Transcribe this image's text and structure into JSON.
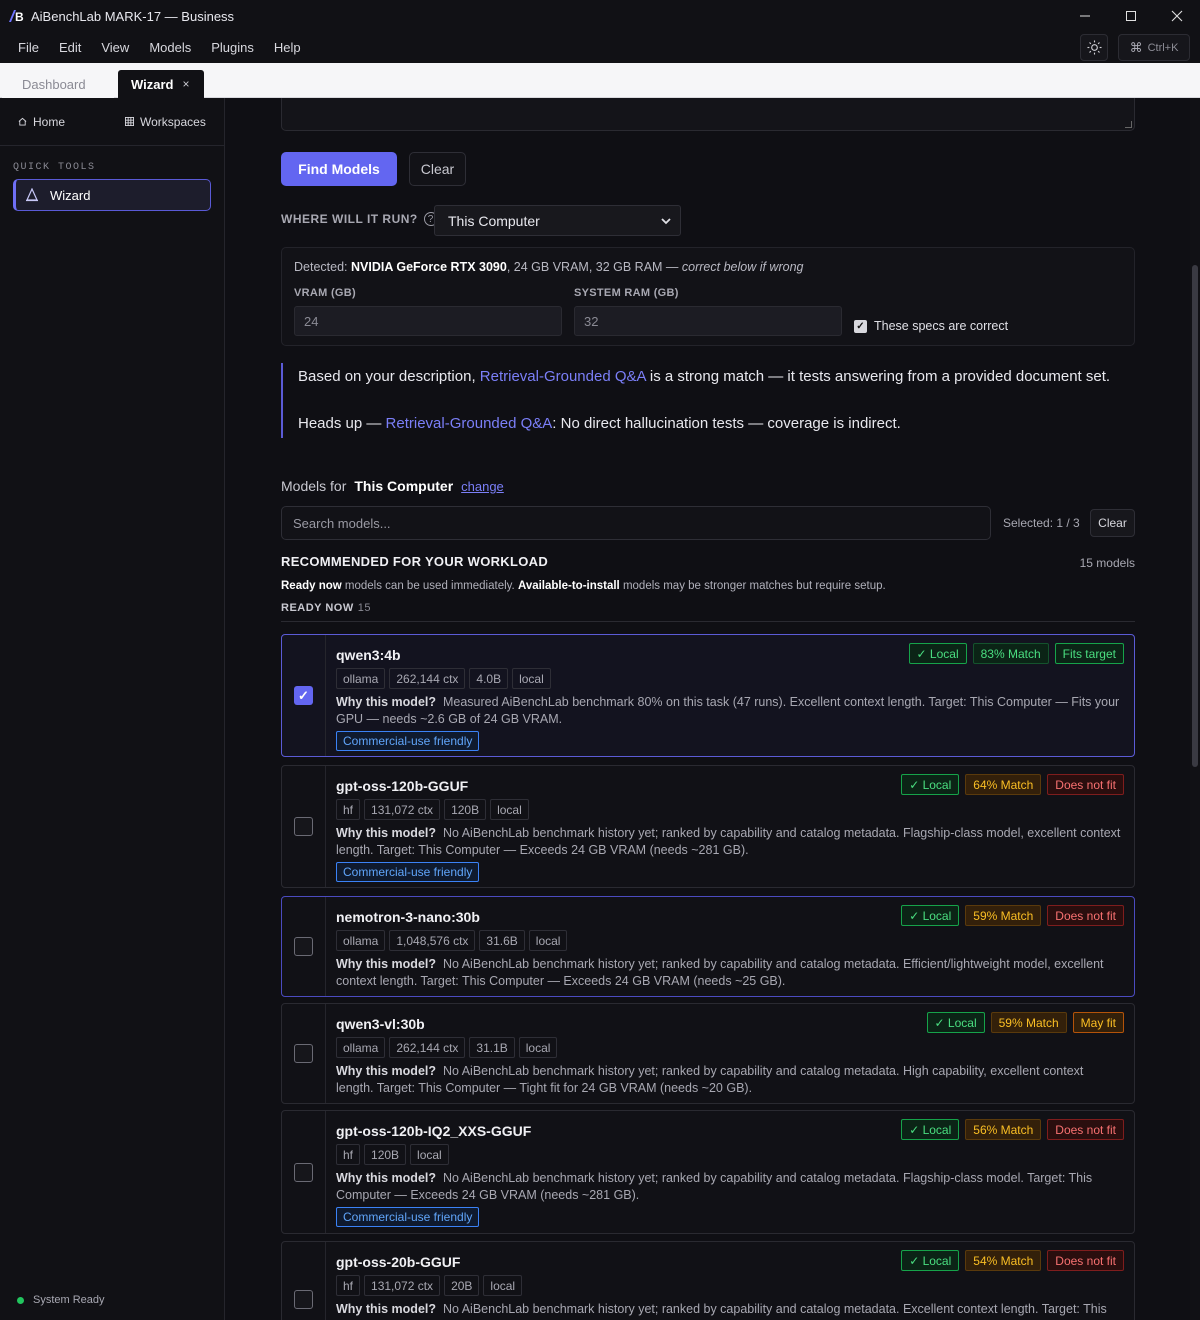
{
  "window": {
    "title": "AiBenchLab MARK-17 — Business",
    "logo_text": "/B",
    "controls": {
      "minimize": "—",
      "maximize": "☐",
      "close": "✕"
    }
  },
  "menu": {
    "items": [
      "File",
      "Edit",
      "View",
      "Models",
      "Plugins",
      "Help"
    ],
    "shortcut": "Ctrl+K"
  },
  "tabs": [
    {
      "label": "Dashboard",
      "active": false
    },
    {
      "label": "Wizard",
      "active": true,
      "close": "×"
    }
  ],
  "sidebar": {
    "home": "Home",
    "workspaces": "Workspaces",
    "section": "QUICK TOOLS",
    "active_item": "Wizard",
    "status": "System Ready",
    "status_color": "#22c55e"
  },
  "actions": {
    "find": "Find Models",
    "clear": "Clear"
  },
  "run": {
    "label": "WHERE WILL IT RUN?",
    "help": "?",
    "selected": "This Computer"
  },
  "specs": {
    "detected_prefix": "Detected:",
    "gpu": "NVIDIA GeForce RTX 3090",
    "details": ", 24 GB VRAM, 32 GB RAM — ",
    "hint": "correct below if wrong",
    "vram_label": "VRAM (GB)",
    "vram_value": "24",
    "ram_label": "SYSTEM RAM (GB)",
    "ram_value": "32",
    "confirm_label": "These specs are correct",
    "confirm_checked": true
  },
  "callout": {
    "line1_prefix": "Based on your description, ",
    "line1_link": "Retrieval-Grounded Q&A",
    "line1_suffix": " is a strong match — it tests answering from a provided document set.",
    "line2_prefix": "Heads up — ",
    "line2_link": "Retrieval-Grounded Q&A",
    "line2_suffix": ": No direct hallucination tests — coverage is indirect."
  },
  "models_for": {
    "prefix": "Models for",
    "target": "This Computer",
    "change": "change"
  },
  "search": {
    "placeholder": "Search models...",
    "selected": "Selected: 1 / 3",
    "clear": "Clear"
  },
  "recommended": {
    "title": "RECOMMENDED FOR YOUR WORKLOAD",
    "count": "15 models",
    "desc_b1": "Ready now",
    "desc_t1": " models can be used immediately. ",
    "desc_b2": "Available-to-install",
    "desc_t2": " models may be stronger matches but require setup.",
    "ready_label": "READY NOW",
    "ready_count": "15"
  },
  "why_label": "Why this model?",
  "models": [
    {
      "name": "qwen3:4b",
      "tags": [
        "ollama",
        "262,144 ctx",
        "4.0B",
        "local"
      ],
      "why": "Measured AiBenchLab benchmark 80% on this task (47 runs). Excellent context length. Target: This Computer — Fits your GPU — needs ~2.6 GB of 24 GB VRAM.",
      "commercial": "Commercial-use friendly",
      "local": "✓ Local",
      "match": "83% Match",
      "fit": "Fits target",
      "checked": true
    },
    {
      "name": "gpt-oss-120b-GGUF",
      "tags": [
        "hf",
        "131,072 ctx",
        "120B",
        "local"
      ],
      "why": "No AiBenchLab benchmark history yet; ranked by capability and catalog metadata. Flagship-class model, excellent context length. Target: This Computer — Exceeds 24 GB VRAM (needs ~281 GB).",
      "commercial": "Commercial-use friendly",
      "local": "✓ Local",
      "match": "64% Match",
      "fit": "Does not fit",
      "checked": false
    },
    {
      "name": "nemotron-3-nano:30b",
      "tags": [
        "ollama",
        "1,048,576 ctx",
        "31.6B",
        "local"
      ],
      "why": "No AiBenchLab benchmark history yet; ranked by capability and catalog metadata. Efficient/lightweight model, excellent context length. Target: This Computer — Exceeds 24 GB VRAM (needs ~25 GB).",
      "commercial": "",
      "local": "✓ Local",
      "match": "59% Match",
      "fit": "Does not fit",
      "checked": false
    },
    {
      "name": "qwen3-vl:30b",
      "tags": [
        "ollama",
        "262,144 ctx",
        "31.1B",
        "local"
      ],
      "why": "No AiBenchLab benchmark history yet; ranked by capability and catalog metadata. High capability, excellent context length. Target: This Computer — Tight fit for 24 GB VRAM (needs ~20 GB).",
      "commercial": "",
      "local": "✓ Local",
      "match": "59% Match",
      "fit": "May fit",
      "checked": false
    },
    {
      "name": "gpt-oss-120b-IQ2_XXS-GGUF",
      "tags": [
        "hf",
        "120B",
        "local"
      ],
      "why": "No AiBenchLab benchmark history yet; ranked by capability and catalog metadata. Flagship-class model. Target: This Computer — Exceeds 24 GB VRAM (needs ~281 GB).",
      "commercial": "Commercial-use friendly",
      "local": "✓ Local",
      "match": "56% Match",
      "fit": "Does not fit",
      "checked": false
    },
    {
      "name": "gpt-oss-20b-GGUF",
      "tags": [
        "hf",
        "131,072 ctx",
        "20B",
        "local"
      ],
      "why": "No AiBenchLab benchmark history yet; ranked by capability and catalog metadata. Excellent context length. Target: This",
      "commercial": "",
      "local": "✓ Local",
      "match": "54% Match",
      "fit": "Does not fit",
      "checked": false
    }
  ]
}
